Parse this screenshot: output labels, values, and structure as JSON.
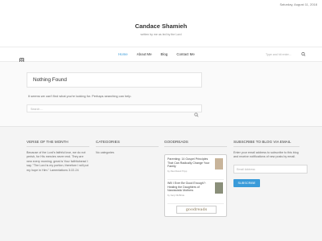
{
  "topbar": {
    "date": "Saturday, August 11, 2018"
  },
  "site": {
    "title": "Candace Shamieh",
    "tagline": "written by me as led by the Lord"
  },
  "nav": {
    "items": [
      {
        "label": "Home",
        "active": true
      },
      {
        "label": "About Me",
        "active": false
      },
      {
        "label": "Blog",
        "active": false
      },
      {
        "label": "Contact Me",
        "active": false
      }
    ],
    "search_placeholder": "Type and hit enter..."
  },
  "main": {
    "heading": "Nothing Found",
    "message": "It seems we can't find what you're looking for. Perhaps searching can help.",
    "search_placeholder": "Search ..."
  },
  "footer": {
    "verse": {
      "heading": "VERSE OF THE MONTH",
      "text": "Because of the Lord's faithful love, we do not perish, for His mercies never end. They are new every morning; great is Your faithfulness! I say, \"The Lord is my portion, therefore I will put my hope in Him.\" Lamentations 3:22-24"
    },
    "categories": {
      "heading": "CATEGORIES",
      "text": "No categories"
    },
    "goodreads": {
      "heading": "GOODREADS",
      "books": [
        {
          "title": "Parenting: 14 Gospel Principles That Can Radically Change Your Family",
          "author": "by Paul David Tripp"
        },
        {
          "title": "Will I Ever Be Good Enough?: Healing the Daughters of Narcissistic Mothers",
          "author": "by Karyl McBride"
        }
      ],
      "logo": "goodreads"
    },
    "subscribe": {
      "heading": "SUBSCRIBE TO BLOG VIA EMAIL",
      "text": "Enter your email address to subscribe to this blog and receive notifications of new posts by email.",
      "input_placeholder": "Email Address",
      "button": "SUBSCRIBE"
    }
  },
  "colors": {
    "accent": "#3a9bd9"
  }
}
